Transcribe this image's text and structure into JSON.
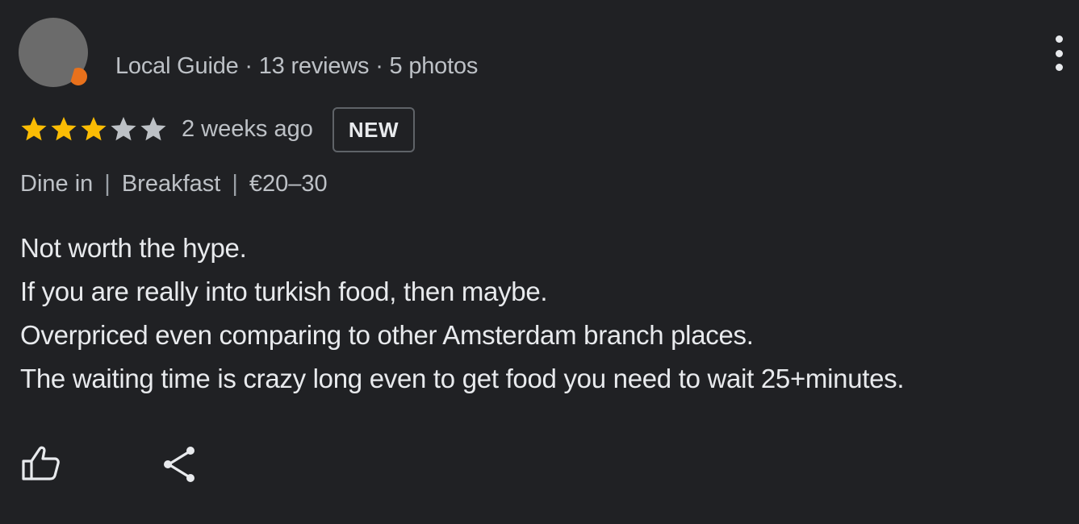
{
  "review": {
    "author_meta": "Local Guide · 13 reviews · 5 photos",
    "rating": 3,
    "rating_max": 5,
    "date": "2 weeks ago",
    "badge": "NEW",
    "tags": [
      "Dine in",
      "Breakfast",
      "€20–30"
    ],
    "tag_separator": "|",
    "body_lines": [
      "Not worth the hype.",
      "If you are really into turkish food, then maybe.",
      "Overpriced even comparing to other Amsterdam branch places.",
      "The waiting time is crazy long even to get food you need to wait 25+minutes."
    ],
    "icons": {
      "more": "more-vert-icon",
      "like": "thumb-up-icon",
      "share": "share-icon"
    }
  },
  "colors": {
    "background": "#202124",
    "star_filled": "#fbbc04",
    "star_empty": "#bdc1c6",
    "text_primary": "#e8eaed",
    "text_secondary": "#bdc1c6"
  }
}
